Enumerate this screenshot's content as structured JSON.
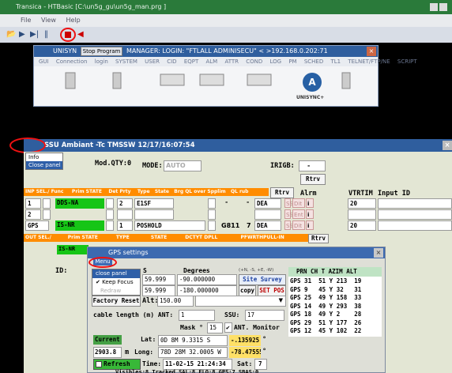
{
  "app": {
    "title": "Transica - HTBasic  [C:\\un5g_gu\\un5g_man.prg ]",
    "menu": [
      "File",
      "View",
      "Help"
    ]
  },
  "manager_window": {
    "title_prefix": "UNISYN",
    "stop_button": "Stop Program",
    "title_suffix": "MANAGER: LOGIN: \"FTLALL ADMINISECU\" < >192.168.0.202:71",
    "menu": [
      "GUI",
      "Connection",
      "login",
      "SYSTEM",
      "USER",
      "CID",
      "EQPT",
      "ALM",
      "ATTR",
      "COND",
      "LOG",
      "PM",
      "SCHED",
      "TL1",
      "TELNET/FTP/NE",
      "SCRIPT"
    ],
    "logo_letter": "A",
    "logo_label": "UNISYNC+"
  },
  "ssu_window": {
    "title": "SSU  Ambiant  -Tc  TMSSW 12/17/16:07:54",
    "context_menu": [
      "Info",
      "Close panel"
    ],
    "mod_qty_label": "Mod.QTY:",
    "mod_qty_value": "0",
    "mode_label": "MODE:",
    "mode_value": "AUTO",
    "irigb_label": "IRIGB:",
    "irigb_value": "-",
    "rtrv_label": "Rtrv",
    "rtrv_label_2": "Rtrv",
    "alrm_label": "Alrm",
    "vtrtim_label": "VTRTIM",
    "input_id_label": "Input ID",
    "inp_header": [
      "INP SEL./",
      "Func",
      "Prim STATE",
      "Det",
      "Prty",
      "Type",
      "State",
      "Brg",
      "QL over",
      "Spplim",
      "QL rub"
    ],
    "rows": [
      {
        "num": "1",
        "state": "DDS-NA",
        "prty": "2",
        "type": "E1SF",
        "ql": "-",
        "ql2": "-",
        "qlsub": "DEA",
        "vtrtim": "20"
      },
      {
        "num": "2",
        "state": "",
        "prty": "",
        "type": "",
        "ql": "",
        "ql2": "",
        "qlsub": "",
        "vtrtim": ""
      },
      {
        "num": "GPS",
        "state": "IS-NR",
        "prty": "1",
        "type": "POSHOLD",
        "ql": "G811",
        "ql2": "7",
        "qlsub": "DEA",
        "vtrtim": "20"
      }
    ],
    "pink_labels": {
      "ssm": "SSM",
      "ent": "Ent",
      "dit": "Dit",
      "i": "i"
    },
    "out_header": [
      "OUT SEL./",
      "Prim STATE",
      "TYPE",
      "STATE",
      "DCTYT DPLL",
      "PFWRTHPULL-IN"
    ],
    "out_state": "IS-NR",
    "id_label": "ID:"
  },
  "gps_settings": {
    "title": "GPS settings",
    "menu_button": "Menu",
    "context_menu": [
      "close panel",
      "Keep Focus",
      "Redraw"
    ],
    "degrees_label": "Degrees",
    "nsew_label": "(+N, -S, +E, -W)",
    "col_s": "S",
    "row1_a": "59.999",
    "row1_b": "-90.000000",
    "site_survey": "Site Survey",
    "row2_a": "59.999",
    "row2_b": "-180.000000",
    "copy": "copy",
    "set_pos": "SET POS",
    "factory_reset": "Factory Reset",
    "alt_label": "Alt:",
    "alt_value": "150.00",
    "cable_label": "cable length (m) ANT:",
    "cable_value": "1",
    "ssu_label": "SSU:",
    "ssu_value": "17",
    "mask_label": "Mask °",
    "mask_value": "15",
    "ant_monitor": "ANT. Monitor",
    "current": "Current",
    "lat_label": "Lat:",
    "lat_value": "0D 8M 9.3315 S",
    "lat_dec": "-.135925",
    "lat_unit": "°",
    "elev": "2903.8",
    "m": "m",
    "long_label": "Long:",
    "long_value": "78D 28M 32.0005 W",
    "long_dec": "-78.47555(",
    "long_unit": "°",
    "refresh": "Refresh",
    "time_label": "Time:",
    "time_value": "11-02-15 21:24:34",
    "sat_label": "Sat:",
    "sat_value": "7",
    "bottom_line": "Visibles:8  Tracked SAL:8 ELO:8 GPS:7 SBAS:0",
    "prn_header": "PRN CH T AZIM ALT",
    "prn_rows": [
      "GPS 31  51 Y 213  19",
      "GPS 9   45 Y 32   31",
      "GPS 25  49 Y 158  33",
      "GPS 14  49 Y 293  38",
      "GPS 18  49 Y 2    28",
      "GPS 29  51 Y 177  26",
      "GPS 12  45 Y 102  22"
    ]
  },
  "colors": {
    "title_green": "#2a7a3a",
    "title_blue": "#2f5e9e",
    "ok_green": "#16c516",
    "header_orange": "#ff8c00",
    "annotation_red": "#e11111"
  }
}
